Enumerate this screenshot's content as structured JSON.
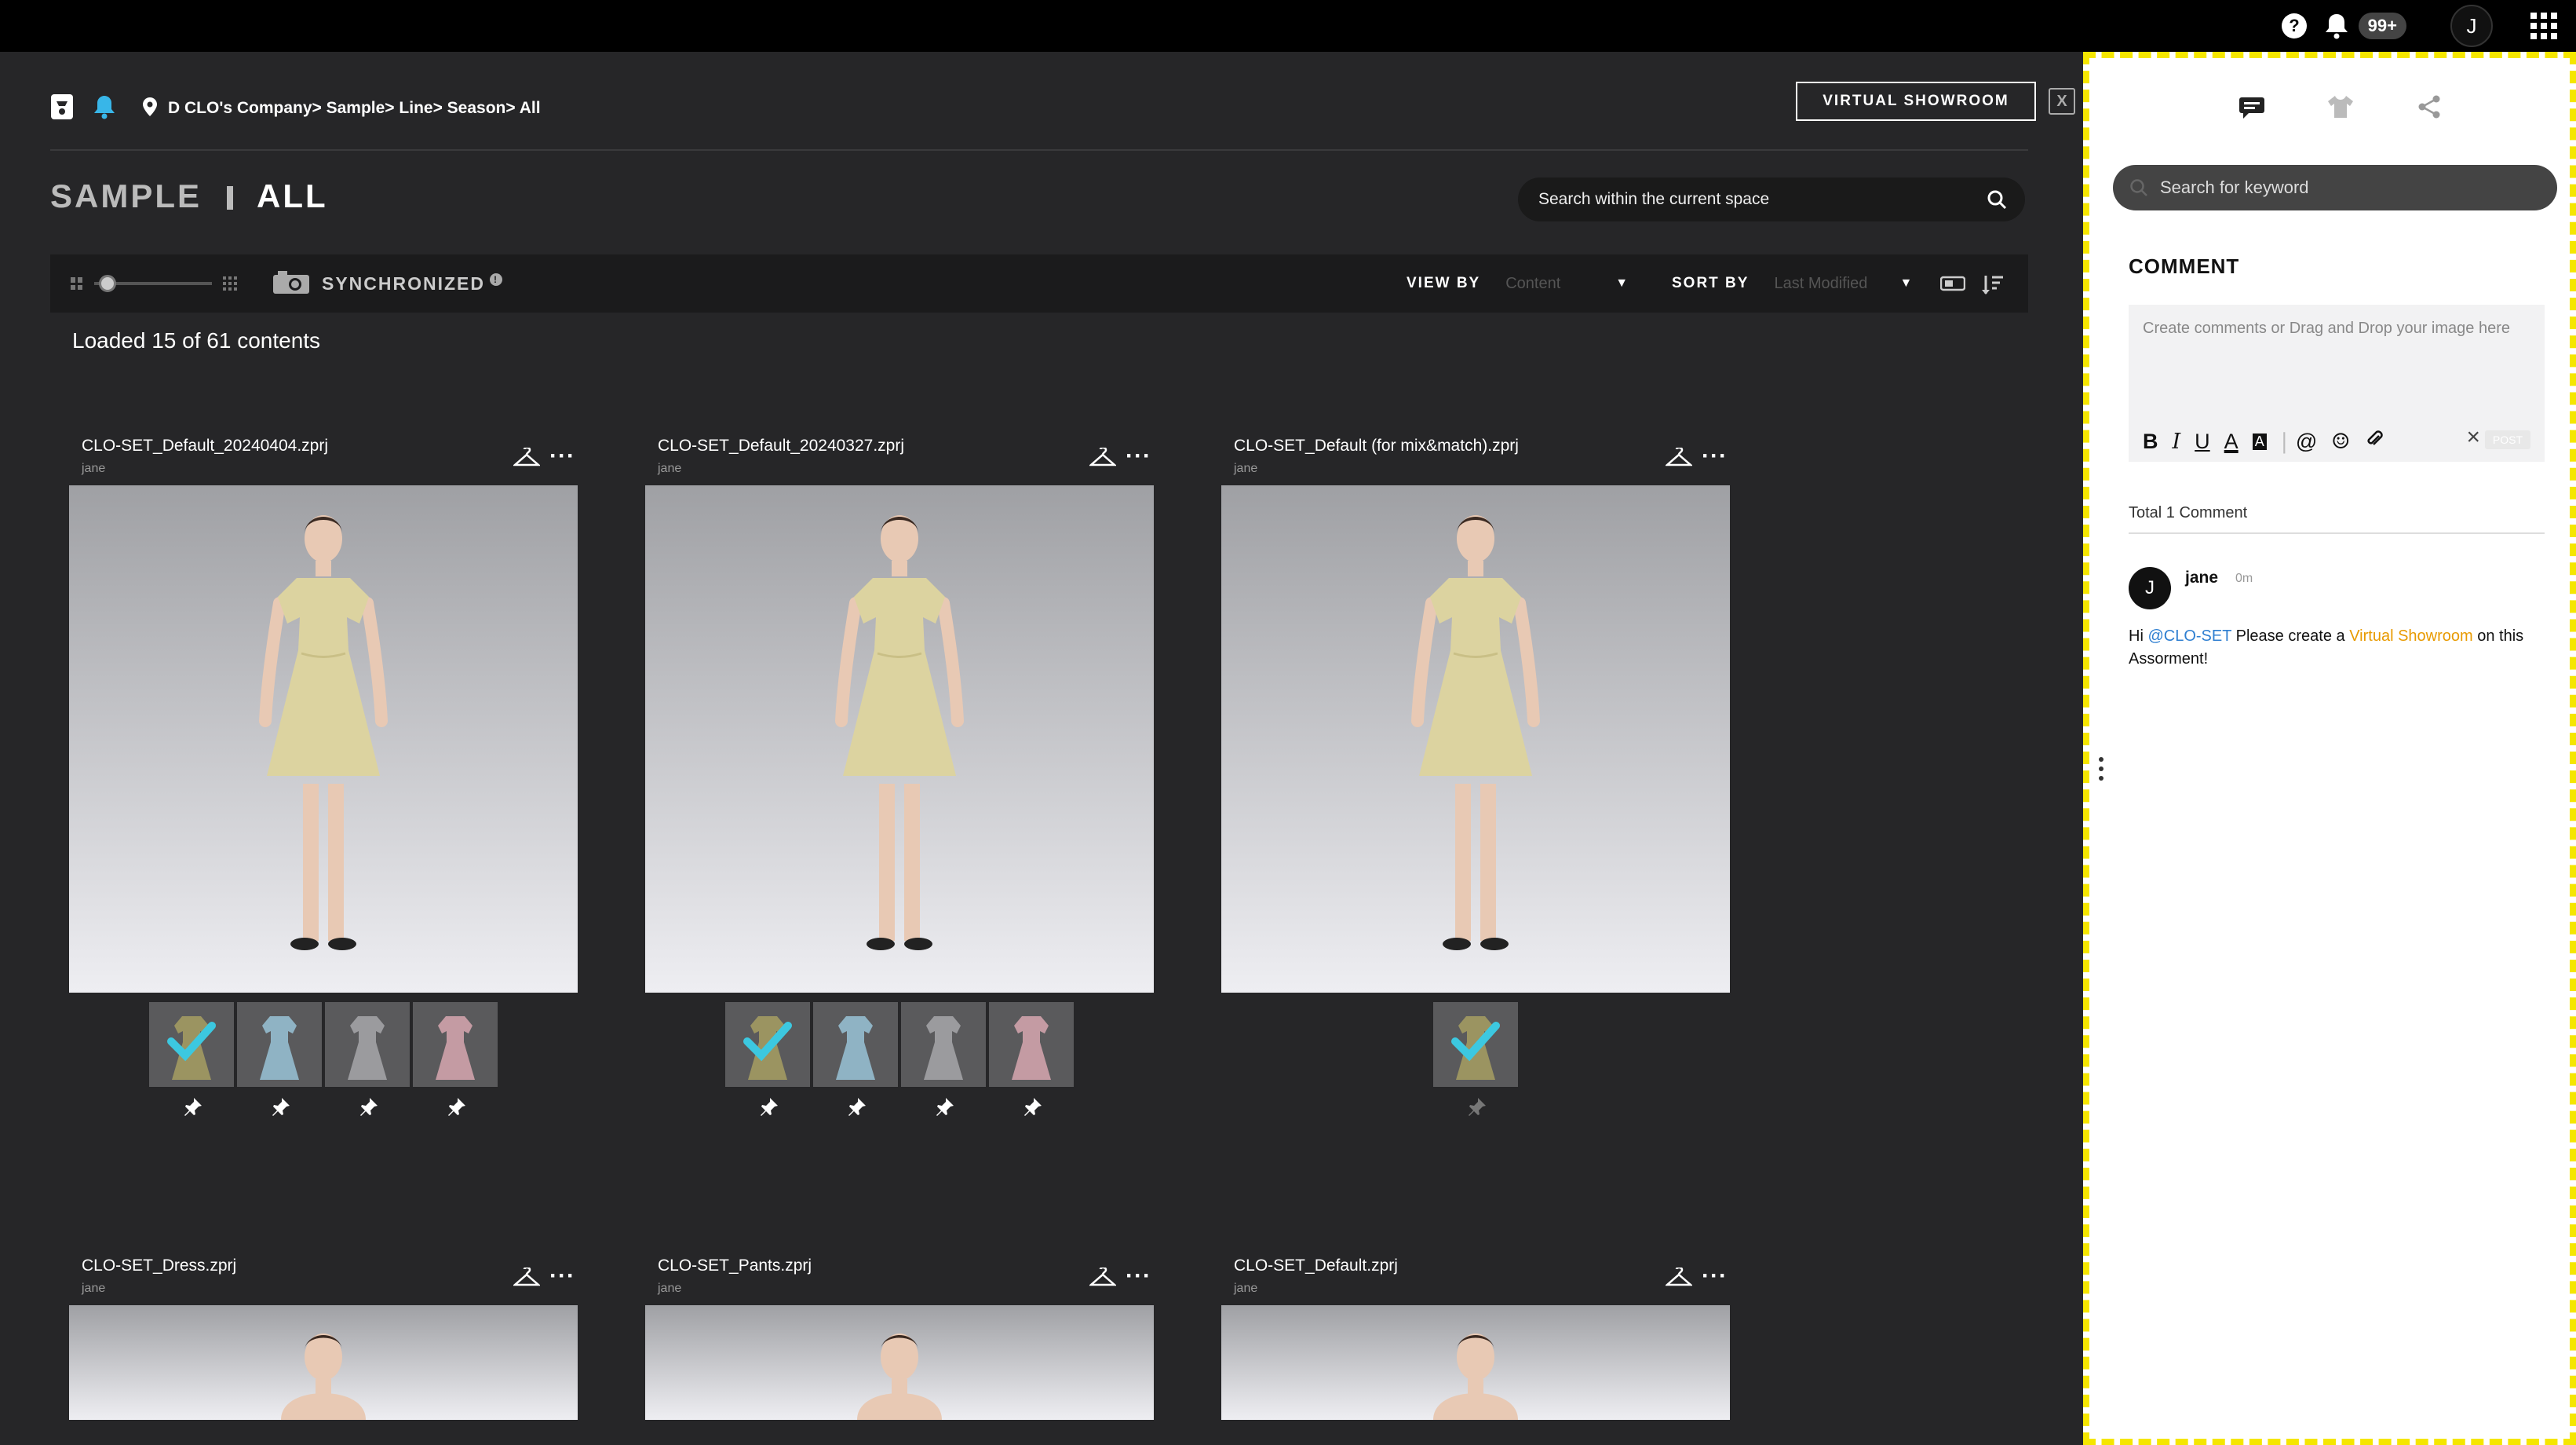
{
  "topbar": {
    "help_icon": "question-circle-icon",
    "bell_icon": "bell-icon",
    "notification_count": "99+",
    "user_initial": "J",
    "apps_icon": "apps-grid-icon"
  },
  "header": {
    "breadcrumb": "D CLO's Company> Sample> Line> Season> All",
    "virtual_showroom_button": "VIRTUAL SHOWROOM",
    "title_space": "SAMPLE",
    "title_view": "ALL",
    "search_placeholder": "Search within the current space"
  },
  "toolbar": {
    "sync_label": "SYNCHRONIZED",
    "view_by_label": "VIEW BY",
    "view_by_value": "Content",
    "sort_by_label": "SORT BY",
    "sort_by_value": "Last Modified"
  },
  "loaded_text": "Loaded 15 of 61 contents",
  "cards": [
    {
      "filename": "CLO-SET_Default_20240404.zprj",
      "owner": "jane",
      "swatches": [
        "#9b9461",
        "#8fb3c4",
        "#9b9b9e",
        "#c49ba3"
      ],
      "selected": 0
    },
    {
      "filename": "CLO-SET_Default_20240327.zprj",
      "owner": "jane",
      "swatches": [
        "#9b9461",
        "#8fb3c4",
        "#9b9b9e",
        "#c49ba3"
      ],
      "selected": 0
    },
    {
      "filename": "CLO-SET_Default (for mix&match).zprj",
      "owner": "jane",
      "swatches": [
        "#9b9461"
      ],
      "selected": 0
    },
    {
      "filename": "CLO-SET_Dress.zprj",
      "owner": "jane"
    },
    {
      "filename": "CLO-SET_Pants.zprj",
      "owner": "jane"
    },
    {
      "filename": "CLO-SET_Default.zprj",
      "owner": "jane"
    }
  ],
  "comment_panel": {
    "search_placeholder": "Search for keyword",
    "title": "COMMENT",
    "input_placeholder": "Create comments or Drag and Drop your image here",
    "post_label": "POST",
    "total": "Total 1 Comment",
    "comment": {
      "initial": "J",
      "author": "jane",
      "time": "0m",
      "greeting": "Hi",
      "mention": "@CLO-SET",
      "text_before": "Please create a",
      "link": "Virtual Showroom",
      "text_after": "on this Assorment!"
    }
  },
  "colors": {
    "accent_yellow": "#f5e600",
    "check_cyan": "#3cc8e0",
    "dress_yellow": "#dcd3a0",
    "bell_cyan": "#38b6e8",
    "mention_blue": "#2f7fd1",
    "link_orange": "#e89a00"
  }
}
